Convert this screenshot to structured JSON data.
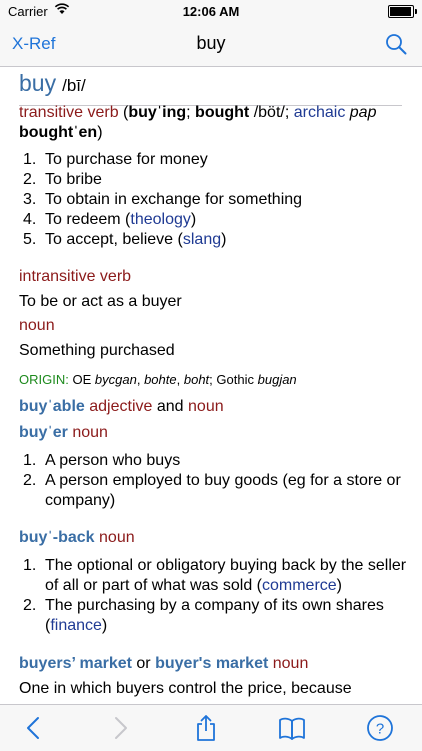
{
  "status": {
    "carrier": "Carrier",
    "time": "12:06 AM",
    "battery_level": 0.95
  },
  "navbar": {
    "back_label": "X-Ref",
    "title": "buy",
    "search_icon": "magnifier-icon"
  },
  "entry": {
    "headword": "buy",
    "pronunciation": "/bī/",
    "transitive": {
      "pos": "transitive verb",
      "forms_prefix": "(",
      "form1": "buyˈing",
      "sep1": ";",
      "form2": "bought",
      "form2_pron": "/böt/",
      "sep2": ";",
      "archaic": "archaic",
      "pap": "pap",
      "form3": "boughtˈen",
      "forms_suffix": ")",
      "senses": [
        {
          "num": "1.",
          "text": "To purchase for money"
        },
        {
          "num": "2.",
          "text": "To bribe"
        },
        {
          "num": "3.",
          "text": "To obtain in exchange for something"
        },
        {
          "num": "4.",
          "text": "To redeem (",
          "label": "theology",
          "tail": ")"
        },
        {
          "num": "5.",
          "text": "To accept, believe (",
          "label": "slang",
          "tail": ")"
        }
      ]
    },
    "intransitive": {
      "pos": "intransitive verb",
      "definition": "To be or act as a buyer"
    },
    "noun": {
      "pos": "noun",
      "definition": "Something purchased"
    },
    "origin": {
      "label": "ORIGIN:",
      "lang1": "OE",
      "w1": "bycgan",
      "sep1": ",",
      "w2": "bohte",
      "sep2": ",",
      "w3": "boht",
      "sep3": ";",
      "lang2": "Gothic",
      "w4": "bugjan"
    },
    "buyable": {
      "word": "buyˈable",
      "pos1": "adjective",
      "and": "and",
      "pos2": "noun"
    },
    "buyer": {
      "word": "buyˈer",
      "pos": "noun",
      "senses": [
        {
          "num": "1.",
          "text": "A person who buys"
        },
        {
          "num": "2.",
          "text": "A person employed to buy goods (eg for a store or company)"
        }
      ]
    },
    "buyback": {
      "word": "buyˈ-back",
      "pos": "noun",
      "senses": [
        {
          "num": "1.",
          "text": "The optional or obligatory buying back by the seller of all or part of what was sold (",
          "label": "commerce",
          "tail": ")"
        },
        {
          "num": "2.",
          "text": "The purchasing by a company of its own shares (",
          "label": "finance",
          "tail": ")"
        }
      ]
    },
    "buyers_market": {
      "word1": "buyers’ market",
      "or": "or",
      "word2": "buyer's market",
      "pos": "noun",
      "definition": "One in which buyers control the price, because"
    }
  },
  "toolbar": {
    "items": [
      "back-arrow-icon",
      "forward-arrow-icon",
      "share-icon",
      "book-icon",
      "help-icon"
    ]
  },
  "colors": {
    "accent": "#1f74d9",
    "maroon": "#8b1a1a",
    "navy": "#1f3a93",
    "headword_blue": "#3a6ea5",
    "origin_green": "#1d8a1d"
  }
}
